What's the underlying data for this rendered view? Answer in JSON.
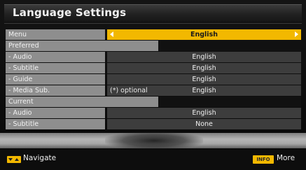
{
  "title": "Language Settings",
  "rows": [
    {
      "label": "Menu",
      "value": "English",
      "type": "selected"
    },
    {
      "label": "Preferred",
      "type": "header"
    },
    {
      "label": "- Audio",
      "value": "English",
      "type": "item"
    },
    {
      "label": "- Subtitle",
      "value": "English",
      "type": "item"
    },
    {
      "label": "- Guide",
      "value": "English",
      "type": "item"
    },
    {
      "label": "- Media Sub.",
      "value": "English",
      "note": "(*) optional",
      "type": "item"
    },
    {
      "label": "Current",
      "type": "header"
    },
    {
      "label": "- Audio",
      "value": "English",
      "type": "item"
    },
    {
      "label": "- Subtitle",
      "value": "None",
      "type": "item"
    }
  ],
  "footer": {
    "navigate_label": "Navigate",
    "info_key": "INFO",
    "more_label": "More"
  },
  "colors": {
    "highlight": "#f2b800",
    "label_bg": "#8e8e8e",
    "value_bg": "#3d3d3d"
  }
}
